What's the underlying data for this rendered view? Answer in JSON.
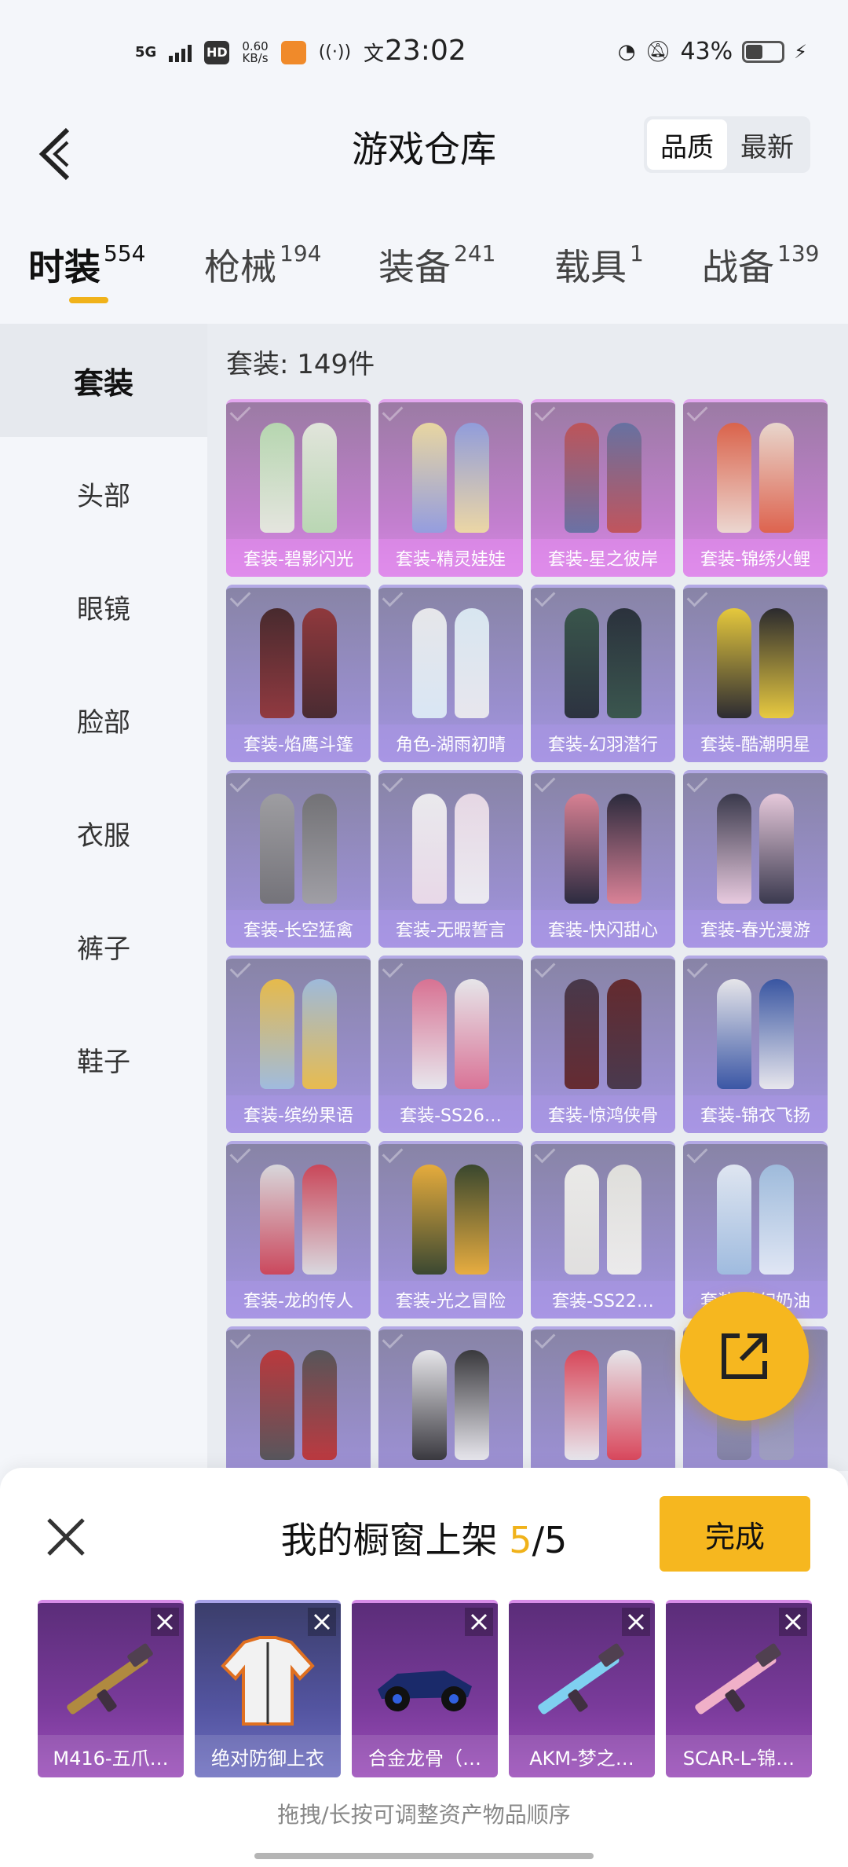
{
  "status_bar": {
    "network": "5G",
    "hd": "HD",
    "speed_value": "0.60",
    "speed_unit": "KB/s",
    "time": "23:02",
    "battery": "43%"
  },
  "nav": {
    "title": "游戏仓库",
    "sort_options": [
      "品质",
      "最新"
    ],
    "sort_selected": "品质"
  },
  "tabs": [
    {
      "label": "时装",
      "count": "554",
      "active": true
    },
    {
      "label": "枪械",
      "count": "194"
    },
    {
      "label": "装备",
      "count": "241"
    },
    {
      "label": "载具",
      "count": "1"
    },
    {
      "label": "战备",
      "count": "139"
    }
  ],
  "sidebar": {
    "items": [
      {
        "label": "套装",
        "active": true
      },
      {
        "label": "头部"
      },
      {
        "label": "眼镜"
      },
      {
        "label": "脸部"
      },
      {
        "label": "衣服"
      },
      {
        "label": "裤子"
      },
      {
        "label": "鞋子"
      }
    ]
  },
  "grid": {
    "count_label": "套装: 149件",
    "items": [
      {
        "name": "套装-碧影闪光",
        "rarity": "pink"
      },
      {
        "name": "套装-精灵娃娃",
        "rarity": "pink"
      },
      {
        "name": "套装-星之彼岸",
        "rarity": "pink"
      },
      {
        "name": "套装-锦绣火鲤",
        "rarity": "pink"
      },
      {
        "name": "套装-焰鹰斗篷",
        "rarity": "purple"
      },
      {
        "name": "角色-湖雨初晴",
        "rarity": "purple"
      },
      {
        "name": "套装-幻羽潜行",
        "rarity": "purple"
      },
      {
        "name": "套装-酷潮明星",
        "rarity": "purple"
      },
      {
        "name": "套装-长空猛禽",
        "rarity": "purple"
      },
      {
        "name": "套装-无暇誓言",
        "rarity": "purple"
      },
      {
        "name": "套装-快闪甜心",
        "rarity": "purple"
      },
      {
        "name": "套装-春光漫游",
        "rarity": "purple"
      },
      {
        "name": "套装-缤纷果语",
        "rarity": "purple"
      },
      {
        "name": "套装-SS26…",
        "rarity": "purple"
      },
      {
        "name": "套装-惊鸿侠骨",
        "rarity": "purple"
      },
      {
        "name": "套装-锦衣飞扬",
        "rarity": "purple"
      },
      {
        "name": "套装-龙的传人",
        "rarity": "purple"
      },
      {
        "name": "套装-光之冒险",
        "rarity": "purple"
      },
      {
        "name": "套装-SS22…",
        "rarity": "purple"
      },
      {
        "name": "套装-梦幻奶油",
        "rarity": "purple"
      },
      {
        "name": "",
        "rarity": "purple"
      },
      {
        "name": "",
        "rarity": "purple"
      },
      {
        "name": "",
        "rarity": "purple"
      },
      {
        "name": "",
        "rarity": "purple"
      }
    ]
  },
  "panel": {
    "title_prefix": "我的橱窗上架 ",
    "count_current": "5",
    "count_total": "/5",
    "done_label": "完成",
    "items": [
      {
        "name": "M416-五爪…",
        "rarity": "pink"
      },
      {
        "name": "绝对防御上衣",
        "rarity": "purple"
      },
      {
        "name": "合金龙骨（…",
        "rarity": "pink"
      },
      {
        "name": "AKM-梦之…",
        "rarity": "pink"
      },
      {
        "name": "SCAR-L-锦…",
        "rarity": "pink"
      }
    ],
    "hint": "拖拽/长按可调整资产物品顺序"
  },
  "colors": {
    "accent": "#f6b71f",
    "legendary": "#d98ce6",
    "epic": "#a797e3"
  }
}
